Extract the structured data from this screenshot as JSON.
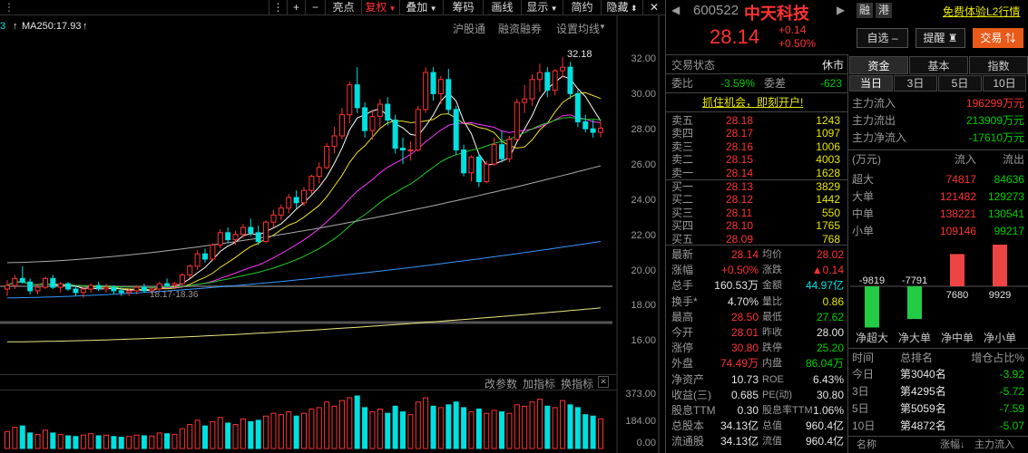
{
  "toolbar": {
    "items": [
      "亮点",
      "复权",
      "叠加",
      "筹码",
      "画线",
      "显示",
      "简约",
      "隐藏"
    ],
    "plus": "+",
    "minus": "−",
    "nav_dots": "⋮",
    "close": "✕"
  },
  "chart_header": {
    "ma250": "MA250:17.93",
    "links": [
      "沪股通",
      "融资融券",
      "设置均线"
    ],
    "peak_label": "32.18",
    "low_label": "18.17-18.36",
    "left_fragment": "3"
  },
  "price_axis": [
    "32.00",
    "30.00",
    "28.00",
    "26.00",
    "24.00",
    "22.00",
    "20.00",
    "18.00",
    "16.00"
  ],
  "indicator_bar": [
    "改参数",
    "加指标",
    "换指标"
  ],
  "volume_axis": [
    "373.00",
    "184.00",
    "0.00"
  ],
  "stock": {
    "code": "600522",
    "name": "中天科技",
    "price": "28.14",
    "change": "+0.14",
    "change_pct": "+0.50%",
    "badges": [
      "融",
      "港"
    ],
    "l2_link": "免费体验L2行情",
    "buttons": [
      "自选",
      "提醒",
      "交易"
    ]
  },
  "trade_status": {
    "label": "交易状态",
    "value": "休市"
  },
  "ratio": {
    "weibi_label": "委比",
    "weibi": "-3.59%",
    "weicha_label": "委差",
    "weicha": "-623"
  },
  "promo": "抓住机会，即刻开户!",
  "sell_orders": [
    {
      "label": "卖五",
      "price": "28.18",
      "vol": "1243"
    },
    {
      "label": "卖四",
      "price": "28.17",
      "vol": "1097"
    },
    {
      "label": "卖三",
      "price": "28.16",
      "vol": "1006"
    },
    {
      "label": "卖二",
      "price": "28.15",
      "vol": "4003"
    },
    {
      "label": "卖一",
      "price": "28.14",
      "vol": "1628"
    }
  ],
  "buy_orders": [
    {
      "label": "买一",
      "price": "28.13",
      "vol": "3829"
    },
    {
      "label": "买二",
      "price": "28.12",
      "vol": "1442"
    },
    {
      "label": "买三",
      "price": "28.11",
      "vol": "550"
    },
    {
      "label": "买四",
      "price": "28.10",
      "vol": "1765"
    },
    {
      "label": "买五",
      "price": "28.09",
      "vol": "768"
    }
  ],
  "quote": [
    {
      "l1": "最新",
      "v1": "28.14",
      "c1": "red",
      "l2": "均价",
      "v2": "28.02",
      "c2": "red"
    },
    {
      "l1": "涨幅",
      "v1": "+0.50%",
      "c1": "red",
      "l2": "涨跌",
      "v2": "▲0.14",
      "c2": "red"
    },
    {
      "l1": "总手",
      "v1": "160.53万",
      "c1": "white",
      "l2": "金额",
      "v2": "44.97亿",
      "c2": "cyan"
    },
    {
      "l1": "换手*",
      "v1": "4.70%",
      "c1": "white",
      "l2": "量比",
      "v2": "0.86",
      "c2": "yellow"
    },
    {
      "l1": "最高",
      "v1": "28.50",
      "c1": "red",
      "l2": "最低",
      "v2": "27.62",
      "c2": "green"
    },
    {
      "l1": "今开",
      "v1": "28.01",
      "c1": "red",
      "l2": "昨收",
      "v2": "28.00",
      "c2": "white"
    },
    {
      "l1": "涨停",
      "v1": "30.80",
      "c1": "red",
      "l2": "跌停",
      "v2": "25.20",
      "c2": "green"
    },
    {
      "l1": "外盘",
      "v1": "74.49万",
      "c1": "red",
      "l2": "内盘",
      "v2": "86.04万",
      "c2": "green"
    },
    {
      "l1": "净资产",
      "v1": "10.73",
      "c1": "white",
      "l2": "ROE",
      "v2": "6.43%",
      "c2": "white"
    },
    {
      "l1": "收益(三)",
      "v1": "0.685",
      "c1": "white",
      "l2": "PE(动)",
      "v2": "30.80",
      "c2": "white"
    },
    {
      "l1": "股息TTM",
      "v1": "0.30",
      "c1": "white",
      "l2": "股息率TTM",
      "v2": "1.06%",
      "c2": "white"
    },
    {
      "l1": "总股本",
      "v1": "34.13亿",
      "c1": "white",
      "l2": "总值",
      "v2": "960.4亿",
      "c2": "white"
    },
    {
      "l1": "流通股",
      "v1": "34.13亿",
      "c1": "white",
      "l2": "流值",
      "v2": "960.4亿",
      "c2": "white"
    }
  ],
  "fund_tabs": [
    "资金",
    "基本",
    "指数"
  ],
  "period_tabs": [
    "当日",
    "3日",
    "5日",
    "10日"
  ],
  "flows": [
    {
      "label": "主力流入",
      "value": "196299万元",
      "color": "red"
    },
    {
      "label": "主力流出",
      "value": "213909万元",
      "color": "green"
    },
    {
      "label": "主力净流入",
      "value": "-17610万元",
      "color": "green"
    }
  ],
  "flow_table": {
    "headers": [
      "(万元)",
      "流入",
      "流出"
    ],
    "rows": [
      {
        "label": "超大",
        "in": "74817",
        "out": "84636"
      },
      {
        "label": "大单",
        "in": "121482",
        "out": "129273"
      },
      {
        "label": "中单",
        "in": "138221",
        "out": "130541"
      },
      {
        "label": "小单",
        "in": "109146",
        "out": "99217"
      }
    ]
  },
  "net_bars": [
    {
      "label": "净超大",
      "value": -9819,
      "text": "-9819"
    },
    {
      "label": "净大单",
      "value": -7791,
      "text": "-7791"
    },
    {
      "label": "净中单",
      "value": 7680,
      "text": "7680"
    },
    {
      "label": "净小单",
      "value": 9929,
      "text": "9929"
    }
  ],
  "rank": {
    "headers": [
      "时间",
      "总排名",
      "增仓占比%"
    ],
    "rows": [
      {
        "t": "今日",
        "r": "第3040名",
        "v": "-3.92"
      },
      {
        "t": "3日",
        "r": "第4295名",
        "v": "-5.72"
      },
      {
        "t": "5日",
        "r": "第5059名",
        "v": "-7.59"
      },
      {
        "t": "10日",
        "r": "第4872名",
        "v": "-5.07"
      }
    ],
    "footer": [
      "名称",
      "涨幅↓",
      "主力流入"
    ]
  },
  "chart_data": {
    "type": "candlestick",
    "ylim": [
      15.5,
      33
    ],
    "ohlc": [
      [
        19.0,
        19.5,
        18.6,
        19.2
      ],
      [
        19.2,
        19.8,
        19.0,
        19.6
      ],
      [
        19.6,
        20.3,
        19.3,
        19.4
      ],
      [
        19.4,
        19.6,
        18.7,
        18.9
      ],
      [
        18.9,
        19.3,
        18.7,
        19.1
      ],
      [
        19.1,
        19.7,
        19.0,
        19.6
      ],
      [
        19.6,
        19.8,
        19.0,
        19.1
      ],
      [
        19.1,
        19.4,
        18.8,
        19.3
      ],
      [
        19.3,
        19.4,
        18.9,
        19.0
      ],
      [
        19.0,
        19.2,
        18.6,
        18.8
      ],
      [
        18.8,
        19.1,
        18.5,
        19.0
      ],
      [
        19.0,
        19.3,
        18.8,
        19.2
      ],
      [
        19.2,
        19.4,
        18.9,
        19.0
      ],
      [
        19.0,
        19.3,
        18.8,
        19.1
      ],
      [
        19.1,
        19.2,
        18.7,
        18.9
      ],
      [
        18.9,
        19.1,
        18.6,
        18.8
      ],
      [
        18.8,
        19.0,
        18.6,
        18.9
      ],
      [
        18.9,
        19.2,
        18.7,
        19.1
      ],
      [
        19.1,
        19.3,
        18.8,
        18.9
      ],
      [
        18.9,
        19.1,
        18.7,
        19.0
      ],
      [
        19.0,
        19.4,
        18.9,
        19.3
      ],
      [
        19.3,
        19.6,
        19.1,
        19.2
      ],
      [
        19.2,
        19.4,
        19.0,
        19.3
      ],
      [
        19.3,
        19.9,
        19.2,
        19.8
      ],
      [
        19.8,
        20.4,
        19.6,
        20.3
      ],
      [
        20.3,
        21.2,
        20.1,
        21.0
      ],
      [
        21.0,
        21.3,
        20.5,
        20.7
      ],
      [
        20.7,
        21.6,
        20.6,
        21.5
      ],
      [
        21.5,
        22.4,
        21.3,
        22.2
      ],
      [
        22.2,
        22.5,
        21.6,
        21.8
      ],
      [
        21.8,
        22.3,
        21.5,
        22.1
      ],
      [
        22.1,
        22.7,
        21.9,
        22.5
      ],
      [
        22.5,
        23.0,
        22.0,
        22.2
      ],
      [
        22.2,
        22.6,
        21.5,
        21.7
      ],
      [
        21.7,
        22.9,
        21.6,
        22.8
      ],
      [
        22.8,
        23.5,
        22.5,
        23.2
      ],
      [
        23.2,
        23.8,
        22.9,
        23.6
      ],
      [
        23.6,
        24.4,
        23.3,
        24.2
      ],
      [
        24.2,
        24.6,
        23.6,
        23.9
      ],
      [
        23.9,
        24.8,
        23.7,
        24.6
      ],
      [
        24.6,
        25.5,
        24.4,
        25.4
      ],
      [
        25.4,
        26.2,
        25.0,
        25.9
      ],
      [
        25.9,
        27.3,
        25.8,
        27.1
      ],
      [
        27.1,
        28.2,
        26.7,
        27.7
      ],
      [
        27.7,
        29.3,
        27.5,
        28.9
      ],
      [
        28.9,
        30.8,
        28.4,
        30.6
      ],
      [
        30.6,
        31.6,
        29.0,
        29.3
      ],
      [
        29.3,
        29.6,
        27.6,
        28.0
      ],
      [
        28.0,
        29.2,
        27.5,
        28.8
      ],
      [
        28.8,
        29.8,
        28.2,
        29.5
      ],
      [
        29.5,
        29.9,
        28.3,
        28.6
      ],
      [
        28.6,
        28.9,
        26.7,
        27.0
      ],
      [
        27.0,
        27.6,
        26.1,
        26.9
      ],
      [
        26.9,
        27.4,
        26.3,
        26.9
      ],
      [
        26.9,
        29.4,
        26.8,
        29.2
      ],
      [
        29.2,
        31.6,
        29.0,
        31.3
      ],
      [
        31.3,
        31.6,
        29.7,
        30.1
      ],
      [
        30.1,
        31.1,
        29.5,
        30.9
      ],
      [
        30.9,
        31.5,
        28.9,
        29.2
      ],
      [
        29.2,
        29.4,
        26.6,
        26.9
      ],
      [
        26.9,
        27.2,
        25.4,
        25.6
      ],
      [
        25.6,
        26.6,
        25.1,
        26.5
      ],
      [
        26.5,
        26.7,
        24.8,
        25.1
      ],
      [
        25.1,
        26.3,
        25.0,
        26.1
      ],
      [
        26.1,
        27.6,
        26.0,
        27.2
      ],
      [
        27.2,
        28.0,
        26.2,
        26.4
      ],
      [
        26.4,
        27.7,
        26.2,
        27.5
      ],
      [
        27.5,
        29.8,
        27.4,
        29.6
      ],
      [
        29.6,
        30.6,
        29.0,
        29.8
      ],
      [
        29.8,
        31.2,
        29.4,
        30.9
      ],
      [
        30.9,
        31.8,
        30.2,
        31.3
      ],
      [
        31.3,
        31.6,
        29.9,
        30.3
      ],
      [
        30.3,
        31.5,
        30.0,
        31.4
      ],
      [
        31.4,
        32.18,
        31.0,
        31.6
      ],
      [
        31.6,
        31.9,
        29.8,
        30.1
      ],
      [
        30.1,
        30.3,
        28.2,
        28.5
      ],
      [
        28.5,
        28.9,
        27.9,
        28.1
      ],
      [
        28.1,
        28.6,
        27.6,
        27.9
      ],
      [
        27.9,
        28.5,
        27.62,
        28.14
      ]
    ],
    "volumes": [
      120,
      150,
      160,
      110,
      100,
      130,
      110,
      100,
      90,
      85,
      95,
      105,
      90,
      95,
      85,
      80,
      85,
      95,
      90,
      88,
      110,
      105,
      100,
      140,
      170,
      200,
      160,
      190,
      220,
      180,
      170,
      210,
      190,
      200,
      230,
      250,
      240,
      260,
      230,
      250,
      280,
      290,
      330,
      300,
      340,
      360,
      373,
      290,
      260,
      280,
      250,
      300,
      260,
      240,
      330,
      360,
      300,
      290,
      310,
      330,
      290,
      260,
      280,
      250,
      270,
      260,
      250,
      310,
      300,
      330,
      350,
      300,
      290,
      340,
      310,
      290,
      240,
      230,
      210
    ]
  }
}
